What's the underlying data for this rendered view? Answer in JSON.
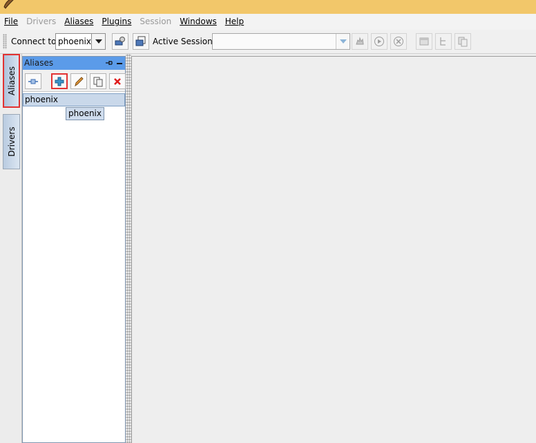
{
  "menu": [
    {
      "label": "File",
      "enabled": true
    },
    {
      "label": "Drivers",
      "enabled": false
    },
    {
      "label": "Aliases",
      "enabled": true
    },
    {
      "label": "Plugins",
      "enabled": true
    },
    {
      "label": "Session",
      "enabled": false
    },
    {
      "label": "Windows",
      "enabled": true
    },
    {
      "label": "Help",
      "enabled": true
    }
  ],
  "toolbar": {
    "connect_label": "Connect to:",
    "connect_value": "phoenix",
    "active_session_label": "Active Session:",
    "active_session_value": ""
  },
  "side_tabs": {
    "aliases": "Aliases",
    "drivers": "Drivers"
  },
  "aliases_panel": {
    "title": "Aliases",
    "items": [
      "phoenix"
    ],
    "tooltip": "phoenix"
  },
  "colors": {
    "title_bar": "#f2c76a",
    "panel_header": "#5b9be9",
    "highlight_border": "#e23232",
    "selection": "#c9d8ea"
  }
}
